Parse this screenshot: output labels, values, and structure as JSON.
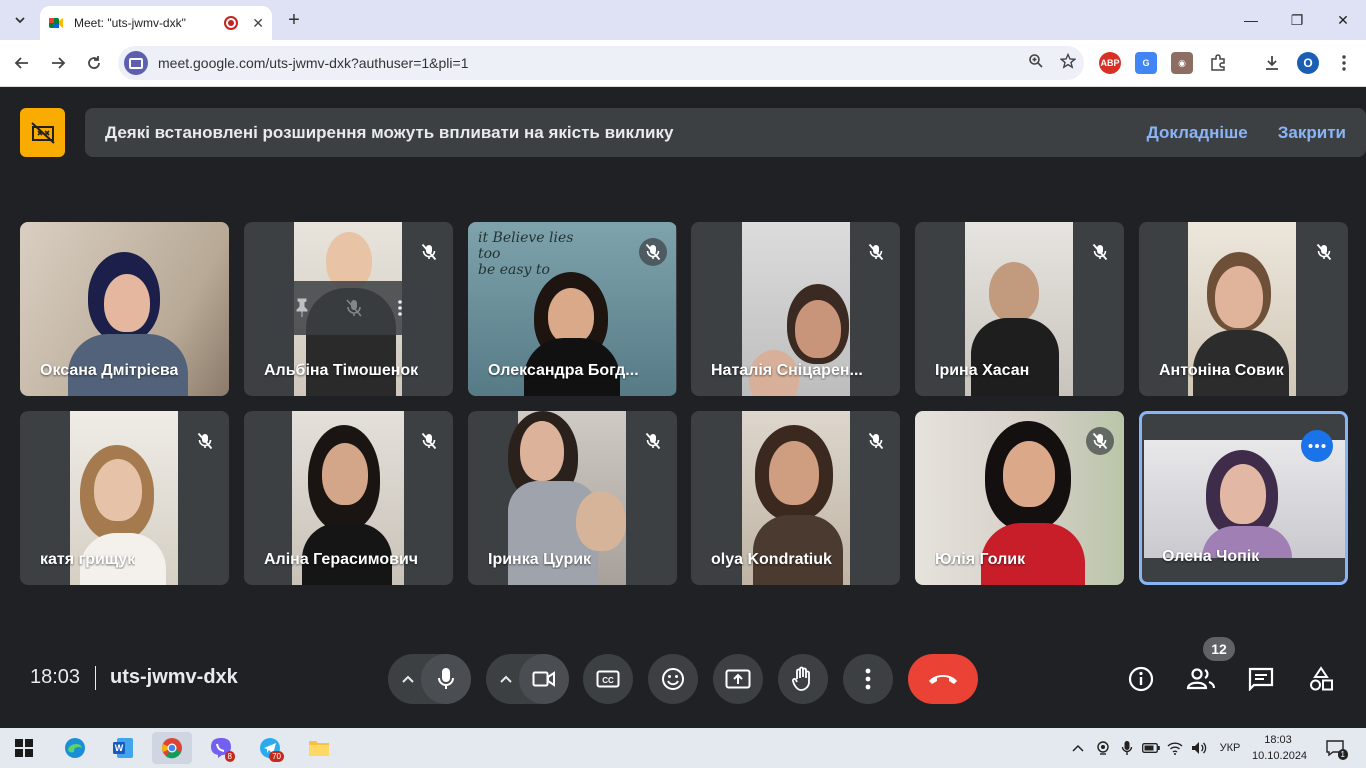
{
  "browser": {
    "tab_title": "Meet: \"uts-jwmv-dxk\"",
    "tab_close": "✕",
    "new_tab": "+",
    "url": "meet.google.com/uts-jwmv-dxk?authuser=1&pli=1",
    "profile_initial": "O",
    "ext_abp": "ABP",
    "win_minimize": "—",
    "win_restore": "❐",
    "win_close": "✕"
  },
  "banner": {
    "text": "Деякі встановлені розширення можуть впливати на якість виклику",
    "learn_more": "Докладніше",
    "close": "Закрити"
  },
  "participants": [
    {
      "name": "Оксана Дмітрієва"
    },
    {
      "name": "Альбіна Тімошенок"
    },
    {
      "name": "Олександра Богд..."
    },
    {
      "name": "Наталія Сніцарен..."
    },
    {
      "name": "Ірина Хасан"
    },
    {
      "name": "Антоніна Совик"
    },
    {
      "name": "катя грищук"
    },
    {
      "name": "Аліна Герасимович"
    },
    {
      "name": "Іринка Цурик"
    },
    {
      "name": "olya Kondratiuk"
    },
    {
      "name": "Юлія Голик"
    },
    {
      "name": "Олена Чопік"
    }
  ],
  "meeting": {
    "time": "18:03",
    "code": "uts-jwmv-dxk",
    "people_count": "12"
  },
  "taskbar": {
    "lang": "УКР",
    "clock_time": "18:03",
    "clock_date": "10.10.2024",
    "viber_badge": "8",
    "telegram_badge": "70",
    "notif_count": "1"
  },
  "colors": {
    "meet_bg": "#202124",
    "tile_bg": "#3c4043",
    "hangup": "#ea4335",
    "link": "#8ab4f8",
    "warning": "#f9ab00"
  }
}
